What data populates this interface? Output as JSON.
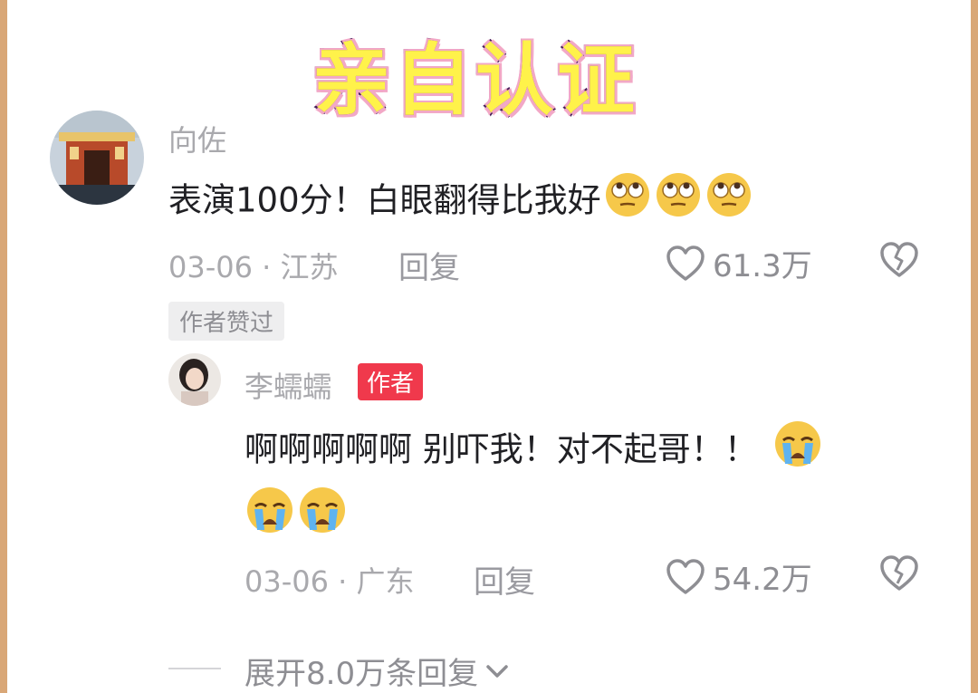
{
  "banner": {
    "title": "亲自认证"
  },
  "comment": {
    "username": "向佐",
    "text": "表演100分！白眼翻得比我好",
    "emoji": "eye-roll-emoji",
    "date_location": "03-06 · 江苏",
    "reply_label": "回复",
    "likes": "61.3万",
    "liked_by_author_tag": "作者赞过"
  },
  "reply": {
    "username": "李蠕蠕",
    "badge": "作者",
    "text_line1": "啊啊啊啊啊 别吓我！对不起哥！！",
    "emoji": "crying-emoji",
    "date_location": "03-06 · 广东",
    "reply_label": "回复",
    "likes": "54.2万"
  },
  "expand": {
    "label": "展开8.0万条回复"
  },
  "colors": {
    "badge_red": "#f0394c",
    "banner_yellow": "#fff24a",
    "frame": "#d9a777"
  }
}
